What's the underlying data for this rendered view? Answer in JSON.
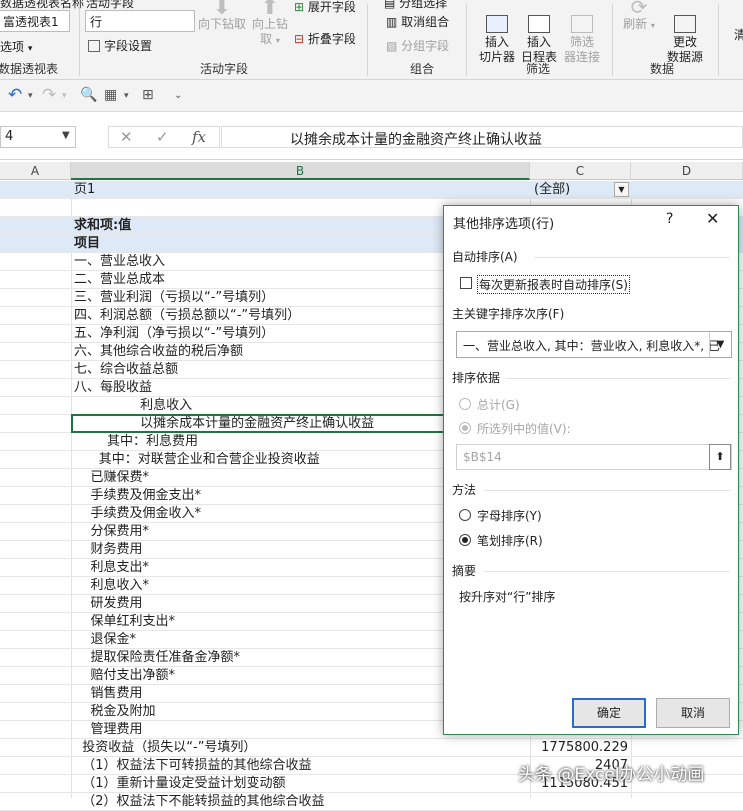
{
  "ribbon": {
    "pivot_name_label": "数据透视表名称",
    "pivot_name_value": "富透视表1",
    "options_label": "选项",
    "pivot_group_label": "数据透视表",
    "active_field_label": "活动字段",
    "active_field_value": "行",
    "field_settings_label": "字段设置",
    "drill_down_label": "向下钻取",
    "drill_up_label": "向上钻取",
    "expand_field_label": "展开字段",
    "collapse_field_label": "折叠字段",
    "active_field_group_label": "活动字段",
    "group_selection_label": "分组选择",
    "ungroup_label": "取消组合",
    "group_field_label": "分组字段",
    "group_group_label": "组合",
    "insert_slicer_label": "插入\n切片器",
    "insert_timeline_label": "插入\n日程表",
    "filter_connections_label": "筛选\n器连接",
    "filter_group_label": "筛选",
    "refresh_label": "刷新",
    "change_source_label": "更改\n数据源",
    "data_group_label": "数据",
    "clear_label": "清"
  },
  "qat": {
    "undo_icon": "undo-icon",
    "redo_icon": "redo-icon"
  },
  "formula_bar": {
    "name_box": "4",
    "cancel_symbol": "✕",
    "enter_symbol": "✓",
    "fx_symbol": "fx",
    "formula": "以摊余成本计量的金融资产终止确认收益"
  },
  "columns": [
    "A",
    "B",
    "C",
    "D"
  ],
  "rows": [
    {
      "b": "页1",
      "c": "(全部)",
      "style": "hl",
      "filter": true
    },
    {
      "b": "",
      "c": ""
    },
    {
      "b": "求和项:值",
      "c": "",
      "style": "hlbold"
    },
    {
      "b": "项目",
      "c": "",
      "style": "hlbold"
    },
    {
      "b": "一、营业总收入",
      "c": ""
    },
    {
      "b": "二、营业总成本",
      "c": ""
    },
    {
      "b": "三、营业利润（亏损以“-”号填列）",
      "c": ""
    },
    {
      "b": "四、利润总额（亏损总额以“-”号填列）",
      "c": ""
    },
    {
      "b": "五、净利润（净亏损以“-”号填列）",
      "c": ""
    },
    {
      "b": "六、其他综合收益的税后净额",
      "c": ""
    },
    {
      "b": "七、综合收益总额",
      "c": ""
    },
    {
      "b": "八、每股收益",
      "c": ""
    },
    {
      "b": "                利息收入",
      "c": ""
    },
    {
      "b": "                以摊余成本计量的金融资产终止确认收益",
      "c": ""
    },
    {
      "b": "        其中：利息费用",
      "c": ""
    },
    {
      "b": "      其中：对联营企业和合营企业投资收益",
      "c": ""
    },
    {
      "b": "    已赚保费*",
      "c": ""
    },
    {
      "b": "    手续费及佣金支出*",
      "c": ""
    },
    {
      "b": "    手续费及佣金收入*",
      "c": ""
    },
    {
      "b": "    分保费用*",
      "c": ""
    },
    {
      "b": "    财务费用",
      "c": ""
    },
    {
      "b": "    利息支出*",
      "c": ""
    },
    {
      "b": "    利息收入*",
      "c": ""
    },
    {
      "b": "    研发费用",
      "c": ""
    },
    {
      "b": "    保单红利支出*",
      "c": ""
    },
    {
      "b": "    退保金*",
      "c": ""
    },
    {
      "b": "    提取保险责任准备金净额*",
      "c": ""
    },
    {
      "b": "    赔付支出净额*",
      "c": ""
    },
    {
      "b": "    销售费用",
      "c": ""
    },
    {
      "b": "    税金及附加",
      "c": ""
    },
    {
      "b": "    管理费用",
      "c": ""
    },
    {
      "b": "  投资收益（损失以“-”号填列）",
      "c": "1775800.229"
    },
    {
      "b": "  （1）权益法下可转损益的其他综合收益",
      "c": "2407"
    },
    {
      "b": "  （1）重新计量设定受益计划变动额",
      "c": "1115080.451"
    },
    {
      "b": "  （2）权益法下不能转损益的其他综合收益",
      "c": ""
    }
  ],
  "dialog": {
    "title": "其他排序选项(行)",
    "help_symbol": "?",
    "close_symbol": "✕",
    "auto_sort_label": "自动排序(A)",
    "auto_sort_checkbox_label": "每次更新报表时自动排序(S)",
    "auto_sort_checked": false,
    "primary_key_label": "主关键字排序次序(F)",
    "primary_key_value": "一、营业总收入, 其中：营业收入, 利息收入*, 已",
    "sort_by_label": "排序依据",
    "grand_total_label": "总计(G)",
    "selected_column_label": "所选列中的值(V):",
    "reference_value": "$B$14",
    "method_label": "方法",
    "alphabetic_label": "字母排序(Y)",
    "stroke_label": "笔划排序(R)",
    "method_selected": "stroke",
    "summary_label": "摘要",
    "summary_text": "按升序对“行”排序",
    "ok_label": "确定",
    "cancel_label": "取消"
  },
  "watermark": "头条 @Excel办公小动画",
  "colors": {
    "accent": "#217346",
    "dialog_border": "#2e8b57",
    "ok_border": "#2c6bc7",
    "pivot_highlight": "#dde9f6"
  }
}
